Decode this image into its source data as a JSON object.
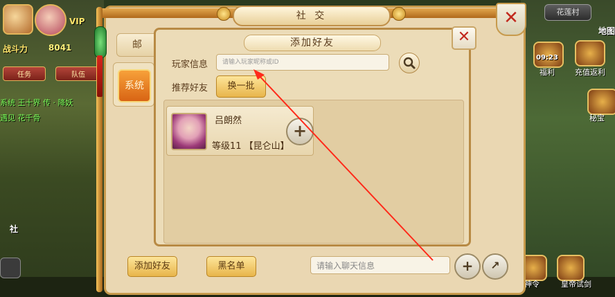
{
  "hud": {
    "vip_label": "VIP",
    "battle_label": "战斗力",
    "battle_value": "8041",
    "task_button": "任务",
    "team_button": "队伍",
    "system_msg_line1": "系统 王十界 传 · 降妖",
    "system_msg_line2": "遇见 花千骨",
    "guild_label": "社"
  },
  "right_bar": {
    "place_label": "花莲村",
    "map_label": "地图",
    "time_label": "09:23",
    "welfare_label": "福利",
    "recharge_label": "充值返利",
    "secret_label": "秘宝",
    "bottom_icons": [
      "神令",
      "皇帝试剑"
    ]
  },
  "social_panel": {
    "title": "社 交",
    "tab_mail": "邮",
    "tab_system": "系统",
    "bottom_add_friend": "添加好友",
    "bottom_blacklist": "黑名单",
    "chat_placeholder": "请输入聊天信息"
  },
  "add_friend_dialog": {
    "title": "添加好友",
    "player_info_label": "玩家信息",
    "search_placeholder": "请输入玩家昵称或ID",
    "recommend_label": "推荐好友",
    "refresh_button": "换一批",
    "friends": [
      {
        "name": "吕朗然",
        "level_faction": "等级11 【昆仑山】"
      }
    ]
  },
  "colors": {
    "panel_bg": "#ead7b2",
    "gold_button": "#e8b54b",
    "close_red": "#c22a1e",
    "arrow_red": "#ff2a1a"
  }
}
